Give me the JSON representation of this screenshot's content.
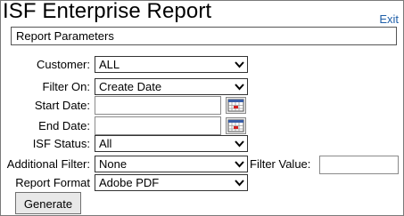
{
  "header": {
    "title": "ISF Enterprise Report",
    "exit_label": "Exit"
  },
  "section": {
    "title": "Report Parameters"
  },
  "form": {
    "customer": {
      "label": "Customer:",
      "value": "ALL"
    },
    "filter_on": {
      "label": "Filter On:",
      "value": "Create Date"
    },
    "start_date": {
      "label": "Start Date:",
      "value": ""
    },
    "end_date": {
      "label": "End Date:",
      "value": ""
    },
    "isf_status": {
      "label": "ISF Status:",
      "value": "All"
    },
    "additional_filter": {
      "label": "Additional Filter:",
      "value": "None"
    },
    "filter_value": {
      "label": "Filter Value:",
      "value": ""
    },
    "report_format": {
      "label": "Report Format",
      "value": "Adobe PDF"
    }
  },
  "actions": {
    "generate_label": "Generate"
  },
  "icons": {
    "dropdown": "chevron-down-icon",
    "calendar": "calendar-icon"
  },
  "colors": {
    "link": "#1f5fa8"
  }
}
